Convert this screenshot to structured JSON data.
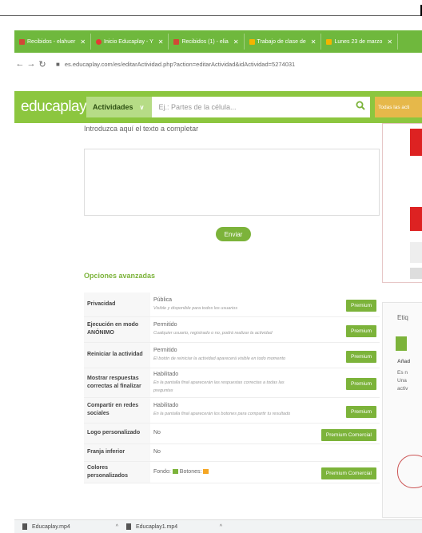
{
  "browser": {
    "tabs": [
      {
        "label": "Recibidos - elahuer",
        "fav": "#d14836"
      },
      {
        "label": "Inicio Educaplay - Y",
        "fav": "#e53935"
      },
      {
        "label": "Recibidos (1) - elia",
        "fav": "#d14836"
      },
      {
        "label": "Trabajo de clase de",
        "fav": "#f4b400"
      },
      {
        "label": "Lunes 23 de marzo",
        "fav": "#f4b400"
      }
    ],
    "url": "es.educaplay.com/es/editarActividad.php?action=editarActividad&idActividad=5274031"
  },
  "site": {
    "logo": "educaplay",
    "activities_label": "Actividades",
    "search_placeholder": "Ej.: Partes de la célula...",
    "all_label": "Todas las acti"
  },
  "form": {
    "textarea_label": "Introduzca aquí el texto a completar",
    "submit_label": "Enviar",
    "advanced_title": "Opciones avanzadas",
    "options": [
      {
        "label": "Privacidad",
        "value": "Pública",
        "note": "Visible y disponible para todos los usuarios",
        "button": "Premium"
      },
      {
        "label": "Ejecución en modo ANÓNIMO",
        "value": "Permitido",
        "note": "Cualquier usuario, registrado o no, podrá realizar la actividad",
        "button": "Premium"
      },
      {
        "label": "Reiniciar la actividad",
        "value": "Permitido",
        "note": "El botón de reiniciar la actividad aparecerá visible en todo momento",
        "button": "Premium"
      },
      {
        "label": "Mostrar respuestas correctas al finalizar",
        "value": "Habilitado",
        "note": "En la pantalla final aparecerán las respuestas correctas a todas las preguntas",
        "button": "Premium"
      },
      {
        "label": "Compartir en redes sociales",
        "value": "Habilitado",
        "note": "En la pantalla final aparecerán los botones para compartir tu resultado",
        "button": "Premium"
      },
      {
        "label": "Logo personalizado",
        "value": "No",
        "note": "",
        "button": "Premium Comercial"
      },
      {
        "label": "Franja inferior",
        "value": "No",
        "note": "",
        "button": ""
      },
      {
        "label": "Colores personalizados",
        "value": "Fondo:",
        "value2": "Botones:",
        "note": "",
        "button": "Premium Comercial"
      }
    ]
  },
  "right_panel": {
    "t1": "Etiq",
    "t2": "Añad",
    "t3": "Es n",
    "t4": "Una",
    "t5": "activ"
  },
  "downloads": [
    {
      "name": "Educaplay.mp4"
    },
    {
      "name": "Educaplay1.mp4"
    }
  ],
  "colors": {
    "brand": "#8cc63f",
    "accent": "#7cb33a",
    "swatch_green": "#7cb33a",
    "swatch_orange": "#f5a623"
  }
}
